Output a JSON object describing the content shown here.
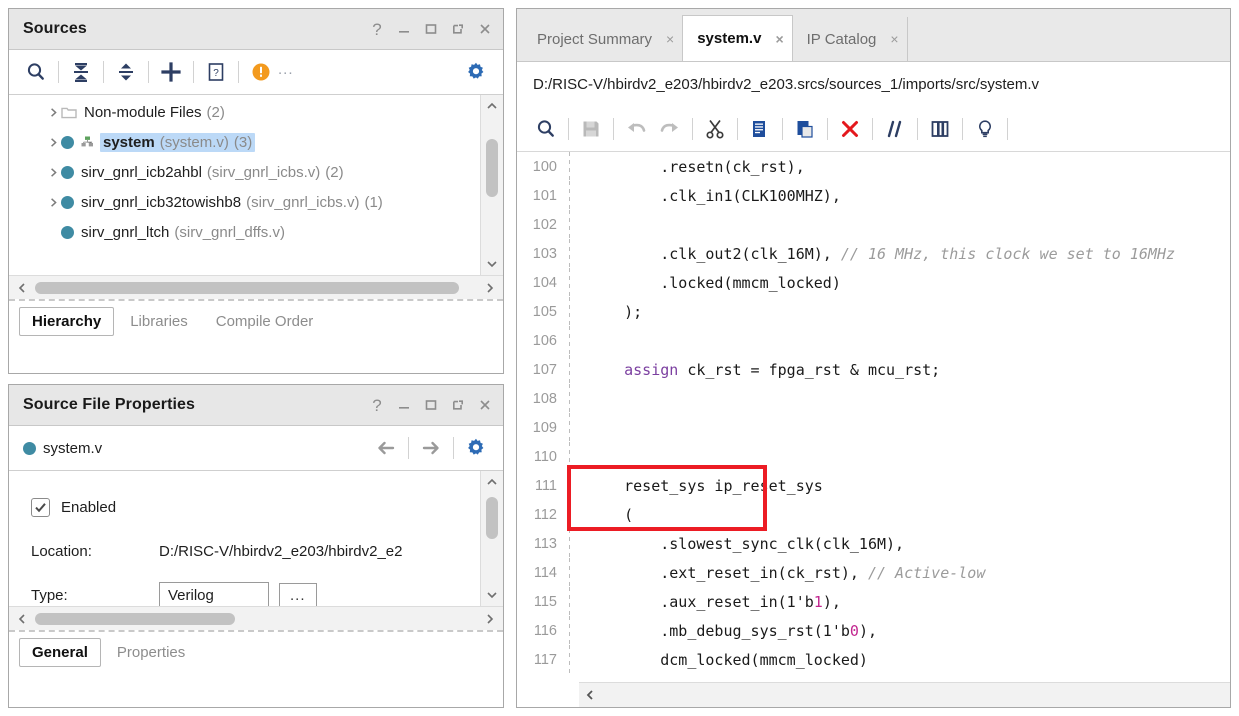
{
  "sources_panel": {
    "title": "Sources",
    "window_buttons": [
      "help-icon",
      "minimize-icon",
      "maximize-icon",
      "float-icon",
      "close-icon"
    ],
    "toolbar": {
      "icons": [
        "search-icon",
        "collapse-all-icon",
        "expand-all-icon",
        "add-sources-icon",
        "help-document-icon",
        "warning-icon",
        "settings-gear-icon"
      ],
      "warning_text": "...",
      "warning_color": "#f39a1e"
    },
    "tree": [
      {
        "label": "Non-module Files",
        "file": "",
        "count": "(2)",
        "icon": "folder-icon",
        "expandable": true,
        "selected": false,
        "bold": false
      },
      {
        "label": "system",
        "file": "(system.v)",
        "count": "(3)",
        "icon": "module-icon",
        "expandable": true,
        "selected": true,
        "bold": true
      },
      {
        "label": "sirv_gnrl_icb2ahbl",
        "file": "(sirv_gnrl_icbs.v)",
        "count": "(2)",
        "icon": "module-icon",
        "expandable": true,
        "selected": false,
        "bold": false
      },
      {
        "label": "sirv_gnrl_icb32towishb8",
        "file": "(sirv_gnrl_icbs.v)",
        "count": "(1)",
        "icon": "module-icon",
        "expandable": true,
        "selected": false,
        "bold": false
      },
      {
        "label": "sirv_gnrl_ltch",
        "file": "(sirv_gnrl_dffs.v)",
        "count": "",
        "icon": "module-icon",
        "expandable": false,
        "selected": false,
        "bold": false
      }
    ],
    "tabs": [
      {
        "label": "Hierarchy",
        "active": true
      },
      {
        "label": "Libraries",
        "active": false
      },
      {
        "label": "Compile Order",
        "active": false
      }
    ]
  },
  "properties_panel": {
    "title": "Source File Properties",
    "window_buttons": [
      "help-icon",
      "minimize-icon",
      "maximize-icon",
      "float-icon",
      "close-icon"
    ],
    "file_name": "system.v",
    "nav_icons": [
      "back-arrow-icon",
      "forward-arrow-icon",
      "settings-gear-icon"
    ],
    "fields": {
      "enabled_label": "Enabled",
      "enabled_checked": true,
      "location_label": "Location:",
      "location_value": "D:/RISC-V/hbirdv2_e203/hbirdv2_e2",
      "type_label": "Type:",
      "type_value": "Verilog",
      "browse_label": "..."
    },
    "tabs": [
      {
        "label": "General",
        "active": true
      },
      {
        "label": "Properties",
        "active": false
      }
    ]
  },
  "editor": {
    "tabs": [
      {
        "label": "Project Summary",
        "active": false,
        "close": "×"
      },
      {
        "label": "system.v",
        "active": true,
        "close": "×"
      },
      {
        "label": "IP Catalog",
        "active": false,
        "close": "×"
      }
    ],
    "file_path": "D:/RISC-V/hbirdv2_e203/hbirdv2_e203.srcs/sources_1/imports/src/system.v",
    "toolbar_icons": [
      "find-icon",
      "save-icon",
      "undo-icon",
      "redo-icon",
      "cut-icon",
      "copy-icon",
      "paste-icon",
      "delete-icon",
      "comment-icon",
      "column-select-icon",
      "hint-bulb-icon"
    ],
    "annotation": {
      "color": "#ec1c24",
      "shape": "rectangle",
      "target_lines": [
        "111",
        "112"
      ]
    },
    "code": [
      {
        "num": "100",
        "parts": [
          {
            "t": "        .resetn(ck_rst),",
            "c": "plain"
          }
        ]
      },
      {
        "num": "101",
        "parts": [
          {
            "t": "        .clk_in1(CLK100MHZ),",
            "c": "plain"
          }
        ]
      },
      {
        "num": "102",
        "parts": [
          {
            "t": "",
            "c": "plain"
          }
        ]
      },
      {
        "num": "103",
        "parts": [
          {
            "t": "        .clk_out2(clk_16M), ",
            "c": "plain"
          },
          {
            "t": "// 16 MHz, this clock we set to 16MHz",
            "c": "comment"
          }
        ]
      },
      {
        "num": "104",
        "parts": [
          {
            "t": "        .locked(mmcm_locked)",
            "c": "plain"
          }
        ]
      },
      {
        "num": "105",
        "parts": [
          {
            "t": "    );",
            "c": "plain"
          }
        ]
      },
      {
        "num": "106",
        "parts": [
          {
            "t": "",
            "c": "plain"
          }
        ]
      },
      {
        "num": "107",
        "parts": [
          {
            "t": "    ",
            "c": "plain"
          },
          {
            "t": "assign",
            "c": "keyword"
          },
          {
            "t": " ck_rst = fpga_rst & mcu_rst;",
            "c": "plain"
          }
        ]
      },
      {
        "num": "108",
        "parts": [
          {
            "t": "",
            "c": "plain"
          }
        ]
      },
      {
        "num": "109",
        "parts": [
          {
            "t": "",
            "c": "plain"
          }
        ]
      },
      {
        "num": "110",
        "parts": [
          {
            "t": "",
            "c": "plain"
          }
        ]
      },
      {
        "num": "111",
        "parts": [
          {
            "t": "    reset_sys ip_reset_sys",
            "c": "plain"
          }
        ]
      },
      {
        "num": "112",
        "parts": [
          {
            "t": "    (",
            "c": "plain"
          }
        ]
      },
      {
        "num": "113",
        "parts": [
          {
            "t": "        .slowest_sync_clk(clk_16M),",
            "c": "plain"
          }
        ]
      },
      {
        "num": "114",
        "parts": [
          {
            "t": "        .ext_reset_in(ck_rst), ",
            "c": "plain"
          },
          {
            "t": "// Active-low",
            "c": "comment"
          }
        ]
      },
      {
        "num": "115",
        "parts": [
          {
            "t": "        .aux_reset_in(1'b",
            "c": "plain"
          },
          {
            "t": "1",
            "c": "number"
          },
          {
            "t": "),",
            "c": "plain"
          }
        ]
      },
      {
        "num": "116",
        "parts": [
          {
            "t": "        .mb_debug_sys_rst(1'b",
            "c": "plain"
          },
          {
            "t": "0",
            "c": "number"
          },
          {
            "t": "),",
            "c": "plain"
          }
        ]
      },
      {
        "num": "117",
        "parts": [
          {
            "t": "        dcm_locked(mmcm_locked)",
            "c": "plain"
          }
        ]
      }
    ]
  }
}
